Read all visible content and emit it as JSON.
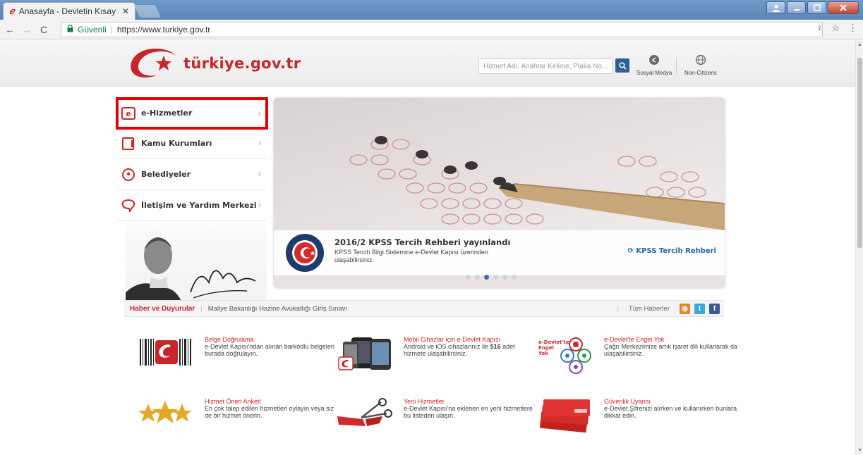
{
  "browser": {
    "tab_title": "Anasayfa - Devletin Kısay",
    "close_glyph": "✕",
    "secure_label": "Güvenli",
    "url": "https://www.turkiye.gov.tr"
  },
  "header": {
    "logo_text": "türkiye.gov.tr",
    "search_placeholder": "Hizmet Adı, Anahtar Kelime, Plaka No...",
    "social_label": "Sosyal Medya",
    "noncitizens_label": "Non-Citizens"
  },
  "menu": {
    "items": [
      {
        "label": "e-Hizmetler"
      },
      {
        "label": "Kamu Kurumları"
      },
      {
        "label": "Belediyeler"
      },
      {
        "label": "İletişim ve Yardım Merkezi"
      }
    ]
  },
  "slider": {
    "title": "2016/2 KPSS Tercih Rehberi yayınlandı",
    "description": "KPSS Tercih Bilgi Sistemine e-Devlet Kapısı üzerinden ulaşabilirsiniz.",
    "link_label": "KPSS Tercih Rehberi",
    "dot_count": 6,
    "active_dot": 2
  },
  "news": {
    "title": "Haber ve Duyurular",
    "item": "Maliye Bakanlığı Hazine Avukatlığı Giriş Sınavı",
    "all_label": "Tüm Haberler"
  },
  "features": [
    {
      "title": "Belge Doğrulama",
      "desc": "e-Devlet Kapısı'ndan alınan barkodlu belgeleri burada doğrulayın."
    },
    {
      "title": "Mobil Cihazlar için e-Devlet Kapısı",
      "desc_pre": "Android ve iOS cihazlarınız ile ",
      "desc_bold": "516",
      "desc_post": " adet hizmete ulaşabilirsiniz."
    },
    {
      "title": "e-Devlet'te Engel Yok",
      "desc": "Çağrı Merkezimize artık işaret dili kullanarak da ulaşabilirsiniz."
    },
    {
      "title": "Hizmet Öneri Anketi",
      "desc": "En çok talep edilen hizmetleri oylayın veya siz de bir hizmet önerin."
    },
    {
      "title": "Yeni Hizmetler",
      "desc": "e-Devlet Kapısı'na eklenen en yeni hizmetlere bu listeden ulaşın."
    },
    {
      "title": "Güvenlik Uyarısı",
      "desc": "e-Devlet Şifrenizi alırken ve kullanırken bunlara dikkat edin."
    }
  ],
  "engel_logo": {
    "line1": "e-Devlet'te",
    "line2": "Engel",
    "line3": "Yok"
  }
}
